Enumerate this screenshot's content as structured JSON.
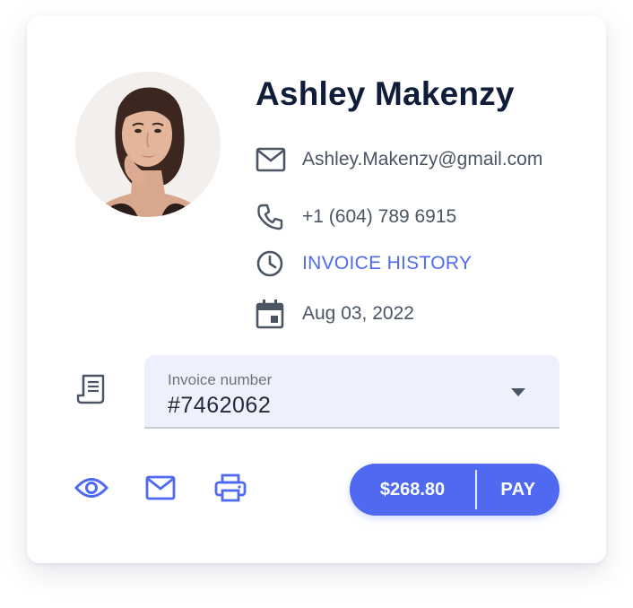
{
  "profile": {
    "name": "Ashley Makenzy",
    "email": "Ashley.Makenzy@gmail.com",
    "phone": "+1 (604) 789 6915",
    "history_link": "INVOICE HISTORY",
    "date": "Aug 03, 2022"
  },
  "invoice_field": {
    "label": "Invoice number",
    "value": "#7462062"
  },
  "payment": {
    "amount": "$268.80",
    "pay_label": "PAY"
  },
  "icons": {
    "email": "mail-icon",
    "phone": "phone-icon",
    "history": "clock-icon",
    "date": "calendar-icon",
    "invoice": "receipt-icon",
    "view": "eye-icon",
    "send": "mail-icon",
    "print": "print-icon",
    "dropdown": "caret-down-icon"
  },
  "colors": {
    "accent": "#4f6af0",
    "heading": "#0f1c3a",
    "text": "#4b5563",
    "field_bg": "#eef1fd"
  }
}
